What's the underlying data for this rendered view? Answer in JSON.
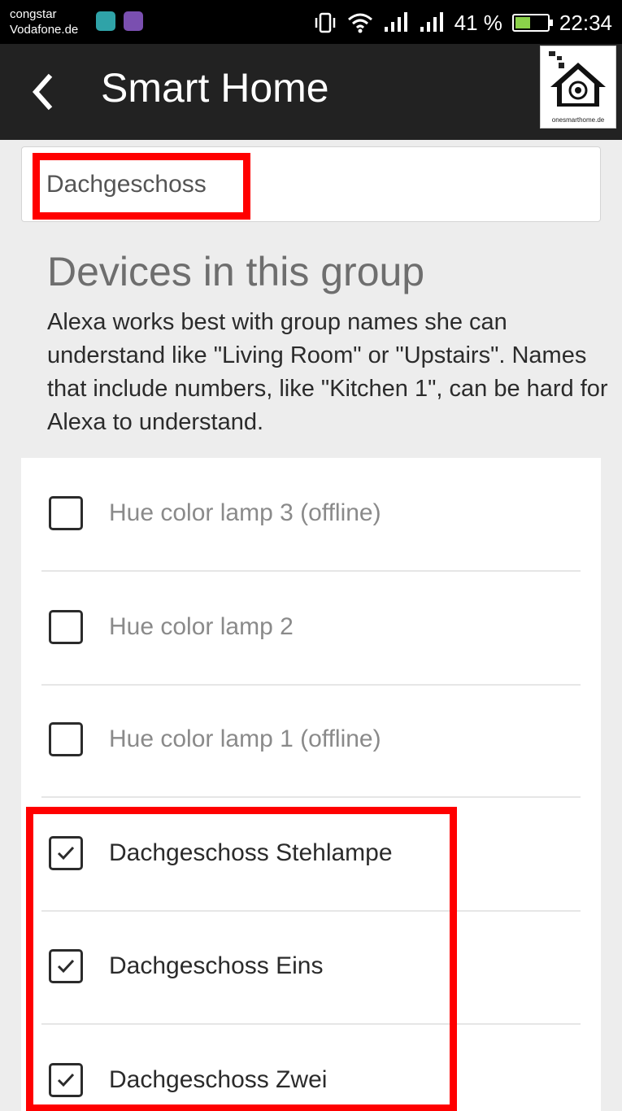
{
  "status_bar": {
    "carrier_line1": "congstar",
    "carrier_line2": "Vodafone.de",
    "battery_percent": "41 %",
    "time": "22:34",
    "icons": [
      "phone-notification-icon",
      "viber-notification-icon",
      "vibrate-icon",
      "wifi-icon",
      "signal-icon",
      "signal-icon",
      "battery-charging-icon"
    ]
  },
  "toolbar": {
    "title": "Smart Home",
    "back_icon": "chevron-left-icon",
    "logo_caption": "onesmarthome.de"
  },
  "group_name": {
    "value": "Dachgeschoss"
  },
  "section": {
    "heading": "Devices in this group",
    "info": "Alexa works best with group names she can understand like \"Living Room\" or \"Upstairs\". Names that include numbers, like \"Kitchen 1\", can be hard for Alexa to understand."
  },
  "devices": [
    {
      "label": "Hue color lamp 3 (offline)",
      "checked": false,
      "offline": true
    },
    {
      "label": "Hue color lamp 2",
      "checked": false,
      "offline": false
    },
    {
      "label": "Hue color lamp 1 (offline)",
      "checked": false,
      "offline": true
    },
    {
      "label": "Dachgeschoss Stehlampe",
      "checked": true,
      "offline": false
    },
    {
      "label": "Dachgeschoss Eins",
      "checked": true,
      "offline": false
    },
    {
      "label": "Dachgeschoss Zwei",
      "checked": true,
      "offline": false
    }
  ],
  "colors": {
    "highlight": "#ff0000",
    "toolbar": "#222222",
    "background": "#ededed"
  }
}
